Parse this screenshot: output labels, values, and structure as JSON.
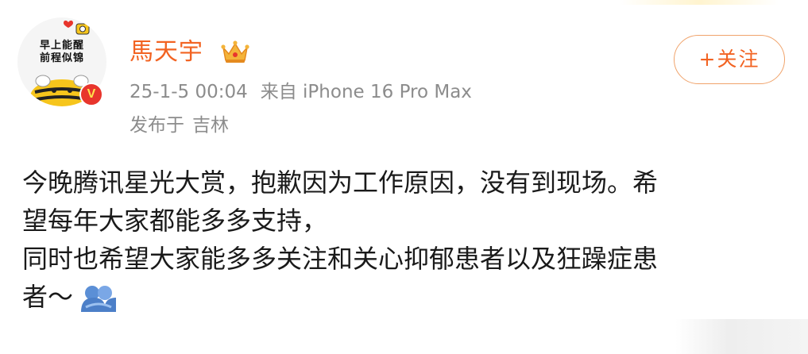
{
  "author": {
    "avatar_text": "早上能醒\n前程似锦",
    "username": "馬天宇",
    "verified_mark": "V"
  },
  "meta": {
    "date_time": "25-1-5 00:04",
    "source": "来自 iPhone 16 Pro Max",
    "location_prefix": "发布于",
    "location": "吉林"
  },
  "follow_button": {
    "label": "+关注"
  },
  "post": {
    "lines": [
      "今晚腾讯星光大赏，抱歉因为工作原因，没有到现场。希",
      "望每年大家都能多多支持，",
      "同时也希望大家能多多关注和关心抑郁患者以及狂躁症患",
      "者～"
    ],
    "emoji": "hug-emoji"
  },
  "colors": {
    "username": "#f26322",
    "meta": "#8c8c8c",
    "follow_border": "#f0a36b",
    "badge_red": "#e8352c",
    "body_text": "#1a1a1a"
  }
}
